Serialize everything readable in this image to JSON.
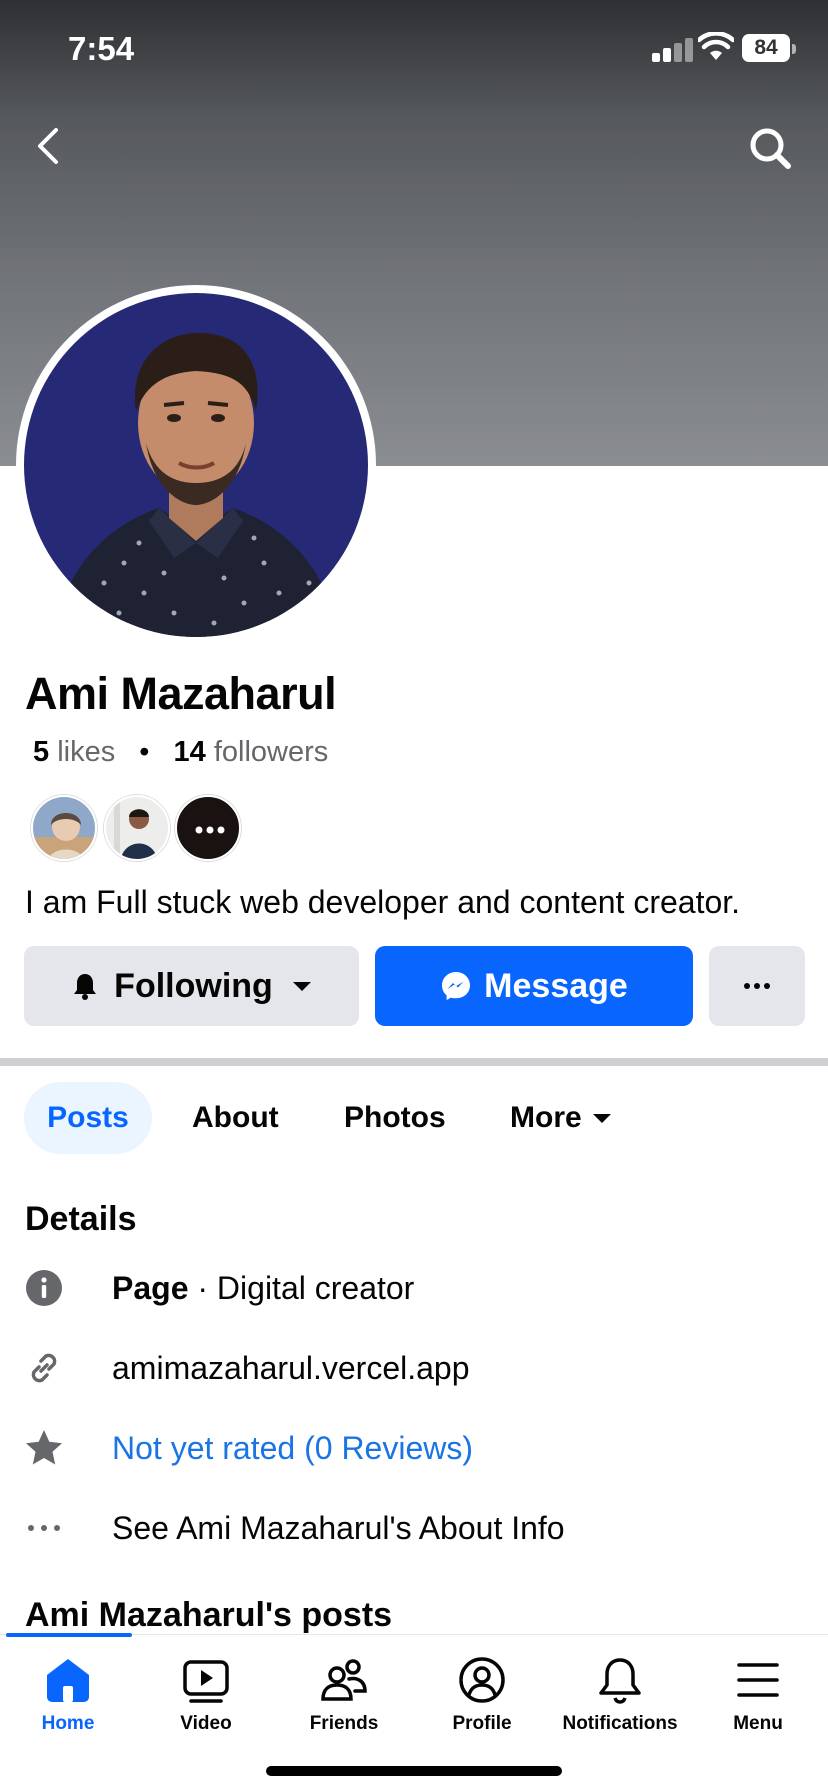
{
  "status_bar": {
    "time": "7:54",
    "battery": "84"
  },
  "profile": {
    "name": "Ami Mazaharul",
    "likes_count": "5",
    "likes_label": "likes",
    "followers_count": "14",
    "followers_label": "followers",
    "bio": "I am Full stuck web developer and content creator."
  },
  "actions": {
    "following_label": "Following",
    "message_label": "Message"
  },
  "tabs": [
    {
      "label": "Posts",
      "active": true
    },
    {
      "label": "About"
    },
    {
      "label": "Photos"
    },
    {
      "label": "More"
    }
  ],
  "details": {
    "title": "Details",
    "category_type": "Page",
    "category_sep": " · ",
    "category_value": "Digital creator",
    "website": "amimazaharul.vercel.app",
    "rating": "Not yet rated (0 Reviews)",
    "about_link": "See Ami Mazaharul's About Info"
  },
  "posts_section": {
    "title": "Ami Mazaharul's posts"
  },
  "bottom_nav": [
    {
      "label": "Home",
      "icon": "home-icon",
      "active": true
    },
    {
      "label": "Video",
      "icon": "video-icon"
    },
    {
      "label": "Friends",
      "icon": "friends-icon"
    },
    {
      "label": "Profile",
      "icon": "profile-icon"
    },
    {
      "label": "Notifications",
      "icon": "bell-icon"
    },
    {
      "label": "Menu",
      "icon": "menu-icon"
    }
  ],
  "colors": {
    "accent": "#0866ff",
    "link": "#1b74e4",
    "button_gray": "#e4e6eb",
    "avatar_bg": "#262975"
  }
}
